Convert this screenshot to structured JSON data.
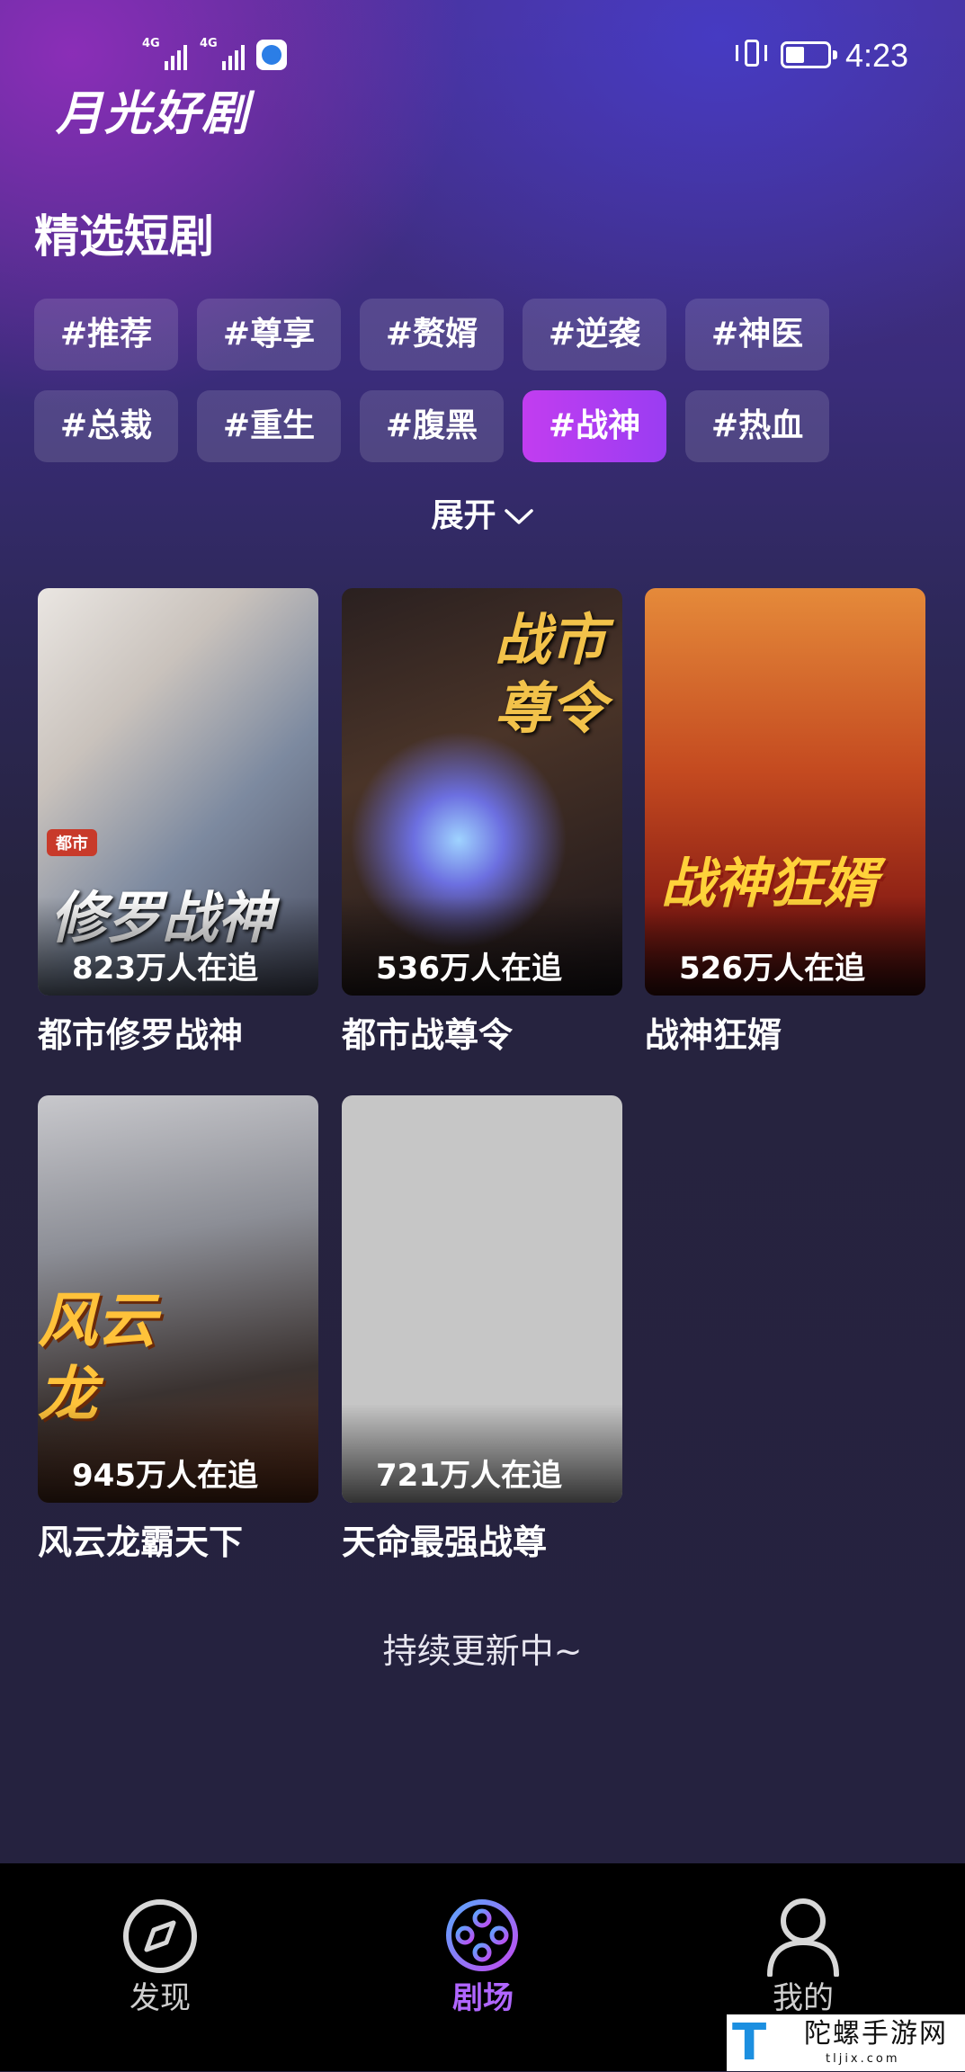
{
  "status_bar": {
    "signal1_label": "4G",
    "signal2_label": "4G",
    "time": "4:23"
  },
  "header": {
    "logo": "月光好剧",
    "section_title": "精选短剧"
  },
  "tags": [
    {
      "label": "#推荐",
      "active": false
    },
    {
      "label": "#尊享",
      "active": false
    },
    {
      "label": "#赘婿",
      "active": false
    },
    {
      "label": "#逆袭",
      "active": false
    },
    {
      "label": "#神医",
      "active": false
    },
    {
      "label": "#总裁",
      "active": false
    },
    {
      "label": "#重生",
      "active": false
    },
    {
      "label": "#腹黑",
      "active": false
    },
    {
      "label": "#战神",
      "active": true
    },
    {
      "label": "#热血",
      "active": false
    }
  ],
  "expand_label": "展开",
  "dramas": [
    {
      "title": "都市修罗战神",
      "followers": "823万人在追",
      "poster_text": "修罗战神",
      "poster_badge": "都市"
    },
    {
      "title": "都市战尊令",
      "followers": "536万人在追",
      "poster_text": "战市尊令"
    },
    {
      "title": "战神狂婿",
      "followers": "526万人在追",
      "poster_text": "战神狂婿"
    },
    {
      "title": "风云龙霸天下",
      "followers": "945万人在追",
      "poster_text": "风云龙"
    },
    {
      "title": "天命最强战尊",
      "followers": "721万人在追"
    }
  ],
  "footer_text": "持续更新中~",
  "nav": {
    "discover": {
      "label": "发现",
      "icon": "compass-icon"
    },
    "theater": {
      "label": "剧场",
      "icon": "film-reel-icon",
      "active": true
    },
    "mine": {
      "label": "我的",
      "icon": "user-icon"
    }
  },
  "watermark": {
    "glyph": "T",
    "text": "陀螺手游网",
    "url": "tljix.com"
  },
  "colors": {
    "active_tag": "#b03df2",
    "active_nav": "#b066ff",
    "background": "#25223f"
  }
}
